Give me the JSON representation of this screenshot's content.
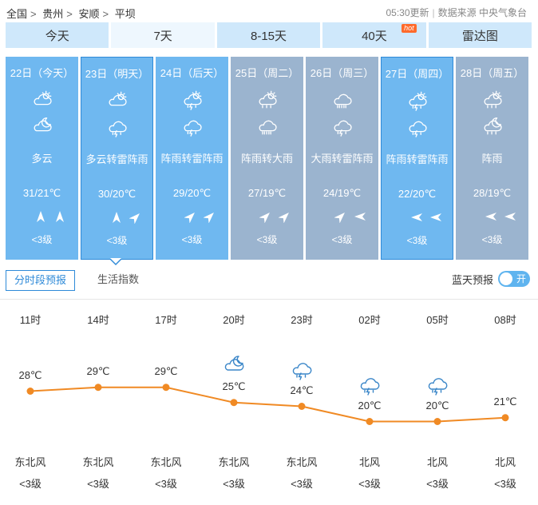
{
  "breadcrumb": {
    "items": [
      "全国",
      "贵州",
      "安顺",
      "平坝"
    ],
    "separator": ">"
  },
  "meta": {
    "updated": "05:30更新",
    "source": "数据来源 中央气象台"
  },
  "tabs": [
    {
      "label": "今天"
    },
    {
      "label": "7天",
      "active": true
    },
    {
      "label": "8-15天"
    },
    {
      "label": "40天",
      "badge": "hot"
    },
    {
      "label": "雷达图"
    }
  ],
  "days": [
    {
      "date": "22日（今天）",
      "icon1": "partly-cloudy-day-icon",
      "icon2": "partly-cloudy-night-icon",
      "desc": "多云",
      "temp": "31/21℃",
      "wind1": "north-arrow",
      "wind2": "north-arrow",
      "level": "<3级",
      "bg": "#6fb8f0"
    },
    {
      "date": "23日（明天）",
      "icon1": "partly-cloudy-day-icon",
      "icon2": "thunderstorm-icon",
      "desc": "多云转雷阵雨",
      "temp": "30/20℃",
      "wind1": "north-arrow",
      "wind2": "northeast-arrow",
      "level": "<3级",
      "bg": "#6fb8f0",
      "selected": true
    },
    {
      "date": "24日（后天）",
      "icon1": "thunder-shower-day-icon",
      "icon2": "thunderstorm-icon",
      "desc": "阵雨转雷阵雨",
      "temp": "29/20℃",
      "wind1": "northeast-arrow",
      "wind2": "northeast-arrow",
      "level": "<3级",
      "bg": "#6fb8f0"
    },
    {
      "date": "25日（周二）",
      "icon1": "shower-day-icon",
      "icon2": "heavy-rain-icon",
      "desc": "阵雨转大雨",
      "temp": "27/19℃",
      "wind1": "northeast-arrow",
      "wind2": "northeast-arrow",
      "level": "<3级",
      "bg": "#9bb4cf"
    },
    {
      "date": "26日（周三）",
      "icon1": "heavy-rain-icon",
      "icon2": "thunderstorm-icon",
      "desc": "大雨转雷阵雨",
      "temp": "24/19℃",
      "wind1": "northeast-arrow",
      "wind2": "west-arrow",
      "level": "<3级",
      "bg": "#9bb4cf"
    },
    {
      "date": "27日（周四）",
      "icon1": "thunder-shower-day-icon",
      "icon2": "thunderstorm-icon",
      "desc": "阵雨转雷阵雨",
      "temp": "22/20℃",
      "wind1": "west-arrow",
      "wind2": "west-arrow",
      "level": "<3级",
      "bg": "#6fb8f0",
      "selected": true
    },
    {
      "date": "28日（周五）",
      "icon1": "shower-day-icon",
      "icon2": "shower-night-icon",
      "desc": "阵雨",
      "temp": "28/19℃",
      "wind1": "west-arrow",
      "wind2": "west-arrow",
      "level": "<3级",
      "bg": "#9bb4cf"
    }
  ],
  "subtabs": {
    "hourly": "分时段预报",
    "life": "生活指数"
  },
  "toggle": {
    "label": "蓝天预报",
    "state": "开"
  },
  "chart_data": {
    "type": "line",
    "x": [
      "11时",
      "14时",
      "17时",
      "20时",
      "23时",
      "02时",
      "05时",
      "08时"
    ],
    "series": [
      {
        "values": [
          28,
          29,
          29,
          25,
          24,
          20,
          20,
          21
        ]
      }
    ],
    "temp_labels": [
      "28℃",
      "29℃",
      "29℃",
      "25℃",
      "24℃",
      "20℃",
      "20℃",
      "21℃"
    ],
    "icons": [
      null,
      null,
      null,
      "partly-cloudy-night-icon",
      "thunderstorm-icon",
      "thunderstorm-icon",
      "thunderstorm-icon",
      null
    ],
    "wind_direction": [
      "东北风",
      "东北风",
      "东北风",
      "东北风",
      "东北风",
      "北风",
      "北风",
      "北风"
    ],
    "wind_level": [
      "<3级",
      "<3级",
      "<3级",
      "<3级",
      "<3级",
      "<3级",
      "<3级",
      "<3级"
    ],
    "line_color": "#f08a24"
  }
}
